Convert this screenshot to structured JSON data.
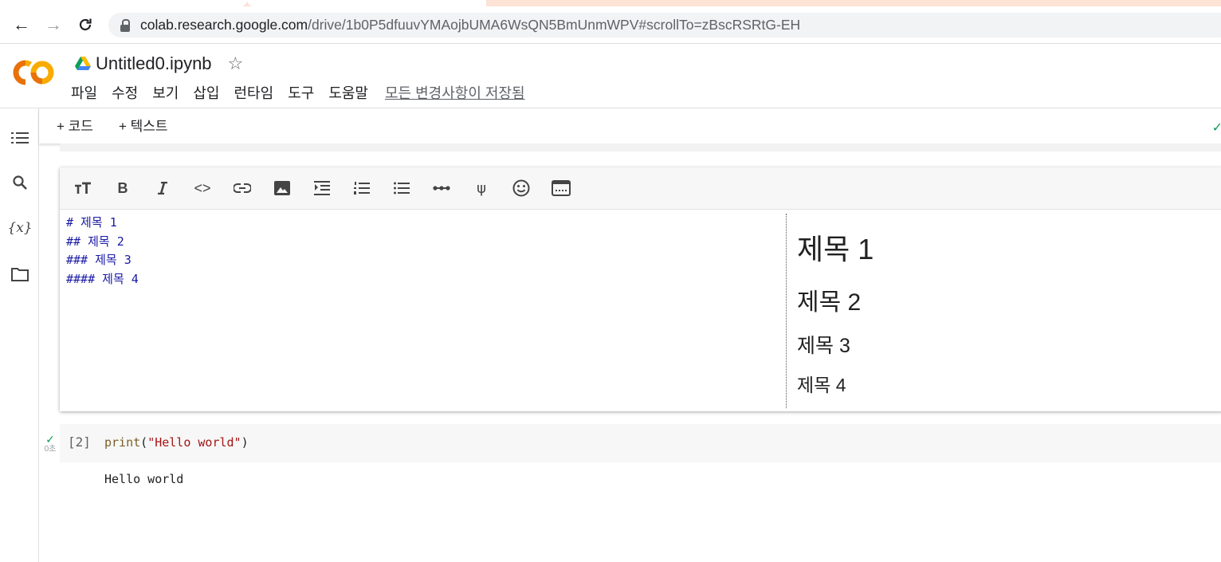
{
  "browser": {
    "url_host": "colab.research.google.com",
    "url_path": "/drive/1b0P5dfuuvYMAojbUMA6WsQN5BmUnmWPV#scrollTo=zBscRSRtG-EH",
    "back_icon": "←",
    "forward_icon": "→",
    "reload_icon": "C"
  },
  "colab": {
    "title": "Untitled0.ipynb",
    "star_icon": "☆",
    "menu": [
      "파일",
      "수정",
      "보기",
      "삽입",
      "런타임",
      "도구",
      "도움말"
    ],
    "save_status": "모든 변경사항이 저장됨",
    "add_code": "+ 코드",
    "add_text": "+ 텍스트"
  },
  "sidebar": {
    "variables_label": "{x}"
  },
  "markdown_cell": {
    "source_lines": [
      "# 제목 1",
      "## 제목 2",
      "### 제목 3",
      "#### 제목 4"
    ],
    "preview": {
      "h1": "제목 1",
      "h2": "제목 2",
      "h3": "제목 3",
      "h4": "제목 4"
    }
  },
  "code_cell": {
    "exec_count": "[2]",
    "code_fn": "print",
    "code_open": "(",
    "code_str": "\"Hello world\"",
    "code_close": ")",
    "status_time": "0초",
    "output": "Hello world"
  },
  "colors": {
    "accent_green": "#0f9d58",
    "md_source": "#1a1aa6",
    "logo_orange": "#f9ab00",
    "logo_dark_orange": "#e8710a"
  }
}
